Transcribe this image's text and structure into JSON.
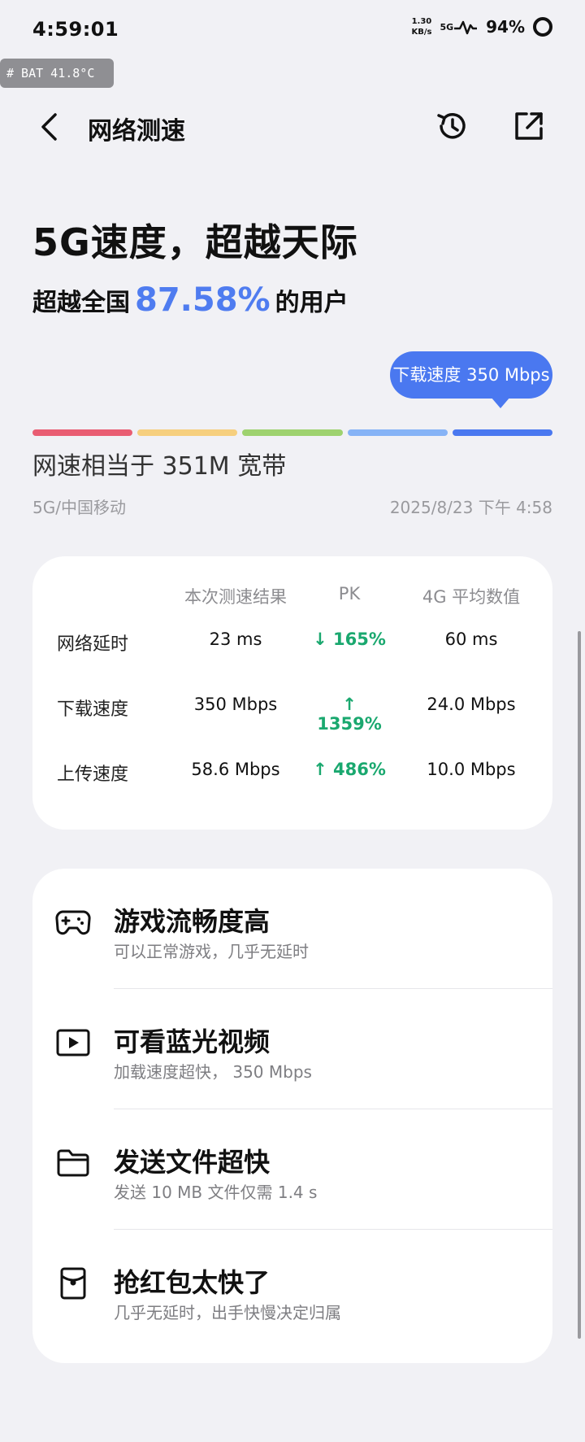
{
  "status_bar": {
    "time": "4:59:01",
    "net_speed_value": "1.30",
    "net_speed_unit": "KB/s",
    "network_type": "5G",
    "battery": "94%"
  },
  "debug_badge": "# BAT 41.8°C",
  "header": {
    "title": "网络测速"
  },
  "hero": {
    "headline": "5G速度，超越天际",
    "sub_prefix": "超越全国",
    "percent": "87.58%",
    "sub_suffix": "的用户"
  },
  "gauge": {
    "tooltip": "下载速度 350 Mbps",
    "segment_colors": [
      "#e95d72",
      "#f6cf7e",
      "#9ed26f",
      "#86b3f6",
      "#4a78f0"
    ],
    "active_segment": 5
  },
  "summary": {
    "equivalent": "网速相当于 351M 宽带",
    "carrier": "5G/中国移动",
    "timestamp": "2025/8/23 下午 4:58"
  },
  "comparison": {
    "headers": [
      "本次测速结果",
      "PK",
      "4G 平均数值"
    ],
    "rows": [
      {
        "label": "网络延时",
        "result": "23 ms",
        "pk_dir": "down",
        "pk": "165%",
        "avg": "60 ms"
      },
      {
        "label": "下载速度",
        "result": "350 Mbps",
        "pk_dir": "up",
        "pk": "1359%",
        "avg": "24.0 Mbps"
      },
      {
        "label": "上传速度",
        "result": "58.6 Mbps",
        "pk_dir": "up",
        "pk": "486%",
        "avg": "10.0 Mbps"
      }
    ],
    "pk_color": "#1aa86f"
  },
  "features": [
    {
      "icon": "gamepad-icon",
      "title": "游戏流畅度高",
      "subtitle": "可以正常游戏，几乎无延时"
    },
    {
      "icon": "video-icon",
      "title": "可看蓝光视频",
      "subtitle": "加载速度超快， 350 Mbps"
    },
    {
      "icon": "folder-icon",
      "title": "发送文件超快",
      "subtitle": "发送 10 MB 文件仅需 1.4 s"
    },
    {
      "icon": "red-packet-icon",
      "title": "抢红包太快了",
      "subtitle": "几乎无延时，出手快慢决定归属"
    }
  ],
  "colors": {
    "accent": "#4a78f0",
    "background": "#f1f1f5"
  }
}
